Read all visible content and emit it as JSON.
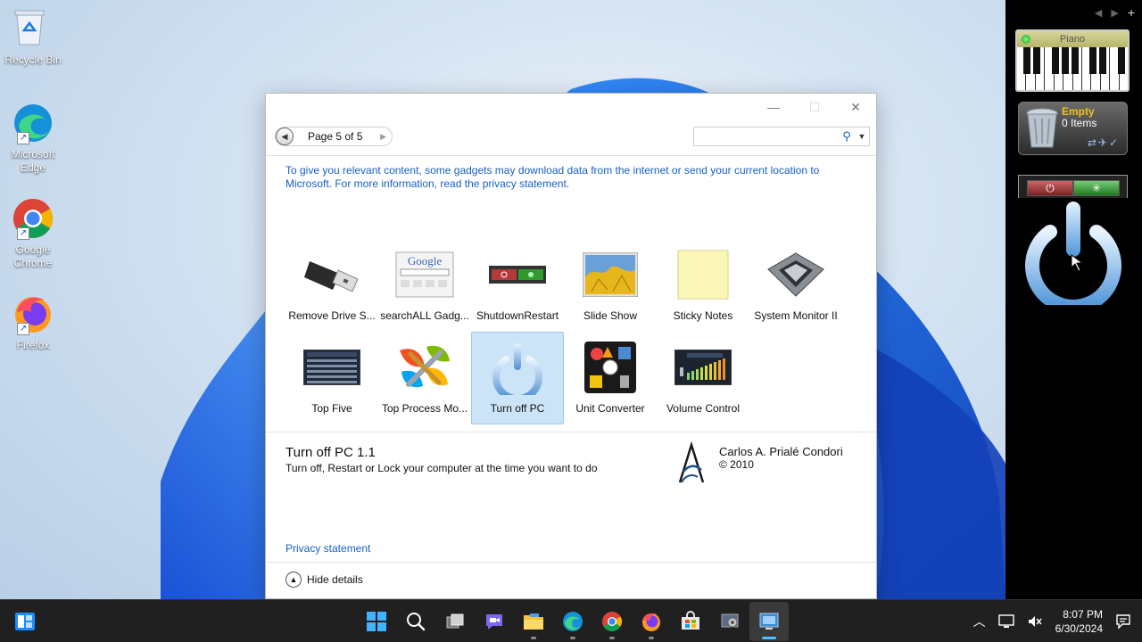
{
  "desktop": {
    "icons": [
      {
        "label": "Recycle Bin",
        "icon": "recycle-bin-icon"
      },
      {
        "label": "Microsoft Edge",
        "icon": "edge-icon"
      },
      {
        "label": "Google Chrome",
        "icon": "chrome-icon"
      },
      {
        "label": "Firefox",
        "icon": "firefox-icon"
      }
    ]
  },
  "sidebar": {
    "nav_prev": "◀",
    "nav_next": "▶",
    "add": "+",
    "piano": {
      "title": "Piano"
    },
    "recycle": {
      "status": "Empty",
      "count": "0 Items"
    },
    "shutdown": {
      "power_symbol": "⏻",
      "restart_symbol": "✳"
    }
  },
  "dialog": {
    "pager": {
      "label": "Page 5 of 5"
    },
    "search": {
      "placeholder": ""
    },
    "info_text": "To give you relevant content, some gadgets may download data from the internet or send your current location to Microsoft. For more information, read the privacy statement.",
    "gadgets": [
      {
        "name": "Remove Drive S...",
        "icon": "usb-drive-icon"
      },
      {
        "name": "searchALL Gadg...",
        "icon": "google-search-icon"
      },
      {
        "name": "ShutdownRestart",
        "icon": "shutdown-restart-icon"
      },
      {
        "name": "Slide Show",
        "icon": "slideshow-icon"
      },
      {
        "name": "Sticky Notes",
        "icon": "sticky-note-icon"
      },
      {
        "name": "System Monitor II",
        "icon": "cpu-chip-icon"
      },
      {
        "name": "Top Five",
        "icon": "process-list-icon"
      },
      {
        "name": "Top Process Mo...",
        "icon": "tools-icon"
      },
      {
        "name": "Turn off PC",
        "icon": "power-icon",
        "selected": true
      },
      {
        "name": "Unit Converter",
        "icon": "unit-converter-icon"
      },
      {
        "name": "Volume Control",
        "icon": "volume-bars-icon"
      }
    ],
    "details": {
      "title": "Turn off PC 1.1",
      "description": "Turn off, Restart or Lock your computer at the time you want to do",
      "author": "Carlos A. Prialé Condori",
      "year": "© 2010"
    },
    "privacy_link": "Privacy statement",
    "hide_details": "Hide details"
  },
  "taskbar": {
    "time": "8:07 PM",
    "date": "6/30/2024",
    "apps": [
      "start-icon",
      "search-icon",
      "task-view-icon",
      "chat-icon",
      "file-explorer-icon",
      "edge-icon",
      "chrome-icon",
      "firefox-icon",
      "store-icon",
      "settings-app-icon",
      "gadgets-app-icon"
    ]
  },
  "colors": {
    "link": "#1660c4",
    "selection": "#cce4f7",
    "taskbar": "#202020",
    "sidebar": "#000000"
  }
}
